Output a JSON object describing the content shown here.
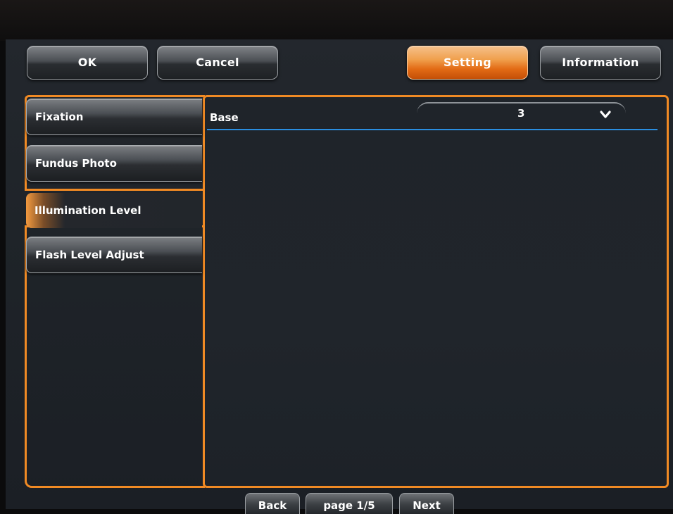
{
  "top_bar": {
    "ok_label": "OK",
    "cancel_label": "Cancel",
    "setting_label": "Setting",
    "information_label": "Information"
  },
  "sidebar": {
    "items": [
      {
        "label": "Fixation",
        "selected": false
      },
      {
        "label": "Fundus Photo",
        "selected": false
      },
      {
        "label": "Illumination Level",
        "selected": true
      },
      {
        "label": "Flash Level Adjust",
        "selected": false
      }
    ]
  },
  "main": {
    "base_label": "Base",
    "base_value": "3",
    "dropdown_icon": "chevron-down-icon"
  },
  "pager": {
    "back_label": "Back",
    "page_label": "page 1/5",
    "next_label": "Next"
  },
  "colors": {
    "accent_orange": "#f08a24",
    "divider_blue": "#2a8ee0",
    "background": "#1f242a"
  }
}
